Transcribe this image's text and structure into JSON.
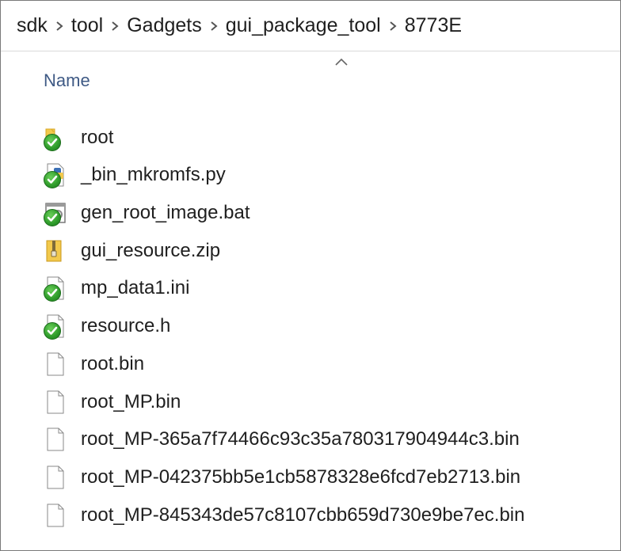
{
  "breadcrumb": [
    "sdk",
    "tool",
    "Gadgets",
    "gui_package_tool",
    "8773E"
  ],
  "column_header": {
    "name": "Name"
  },
  "files": [
    {
      "name": "root",
      "icon": "folder-icon",
      "synced": true
    },
    {
      "name": "_bin_mkromfs.py",
      "icon": "python-file-icon",
      "synced": true
    },
    {
      "name": "gen_root_image.bat",
      "icon": "batch-file-icon",
      "synced": true
    },
    {
      "name": "gui_resource.zip",
      "icon": "zip-folder-icon",
      "synced": false
    },
    {
      "name": "mp_data1.ini",
      "icon": "ini-file-icon",
      "synced": true
    },
    {
      "name": "resource.h",
      "icon": "header-file-icon",
      "synced": true
    },
    {
      "name": "root.bin",
      "icon": "file-icon",
      "synced": false
    },
    {
      "name": "root_MP.bin",
      "icon": "file-icon",
      "synced": false
    },
    {
      "name": "root_MP-365a7f74466c93c35a780317904944c3.bin",
      "icon": "file-icon",
      "synced": false
    },
    {
      "name": "root_MP-042375bb5e1cb5878328e6fcd7eb2713.bin",
      "icon": "file-icon",
      "synced": false
    },
    {
      "name": "root_MP-845343de57c8107cbb659d730e9be7ec.bin",
      "icon": "file-icon",
      "synced": false
    }
  ],
  "colors": {
    "header_text": "#3f5a85",
    "sync_green": "#2e9b2a",
    "folder_yellow": "#f2c94c"
  }
}
